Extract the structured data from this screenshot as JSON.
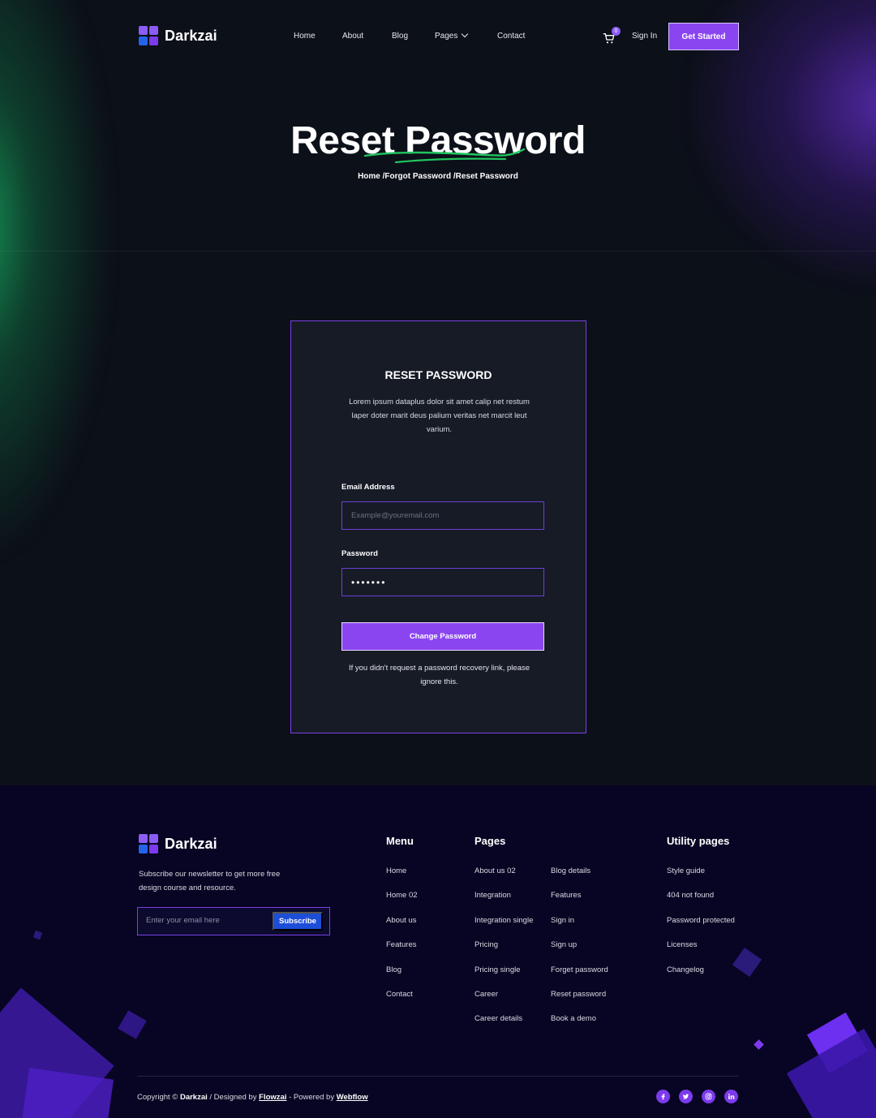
{
  "brand": {
    "name": "Darkzai"
  },
  "nav": {
    "links": [
      "Home",
      "About",
      "Blog",
      "Pages",
      "Contact"
    ],
    "cart_count": "0",
    "signin_label": "Sign In",
    "cta_label": "Get Started"
  },
  "hero": {
    "title": "Reset Password",
    "breadcrumb": "Home /Forgot Password /Reset Password"
  },
  "card": {
    "title": "RESET PASSWORD",
    "description": "Lorem ipsum dataplus dolor sit amet calip net restum laper doter marit deus palium veritas net marcit leut varium.",
    "email_label": "Email Address",
    "email_placeholder": "Example@youremail.com",
    "password_label": "Password",
    "password_value": "•••••••",
    "submit_label": "Change Password",
    "note": "If you didn't request a password recovery link, please ignore this."
  },
  "footer": {
    "description": "Subscribe our newsletter to get more free design course and resource.",
    "newsletter_placeholder": "Enter your email here",
    "subscribe_label": "Subscribe",
    "menu": {
      "title": "Menu",
      "links": [
        "Home",
        "Home 02",
        "About us",
        "Features",
        "Blog",
        "Contact"
      ]
    },
    "pages": {
      "title": "Pages",
      "col1": [
        "About us 02",
        "Integration",
        "Integration single",
        "Pricing",
        "Pricing single",
        "Career",
        "Career details"
      ],
      "col2": [
        "Blog details",
        "Features",
        "Sign in",
        "Sign up",
        "Forget password",
        "Reset password",
        "Book a demo"
      ]
    },
    "utility": {
      "title": "Utility pages",
      "links": [
        "Style guide",
        "404 not found",
        "Password protected",
        "Licenses",
        "Changelog"
      ]
    },
    "copyright": {
      "prefix": "Copyright ©",
      "brand": "Darkzai",
      "designed": "/ Designed by",
      "designer": "Flowzai",
      "powered": "- Powered by",
      "platform": "Webflow"
    },
    "socials": [
      "facebook-icon",
      "twitter-icon",
      "instagram-icon",
      "linkedin-icon"
    ]
  },
  "colors": {
    "accent": "#8b45f0",
    "button_blue": "#1d4ed8",
    "footer_bg": "#070523",
    "card_bg": "#161b26",
    "green_underline": "#22c55e"
  }
}
